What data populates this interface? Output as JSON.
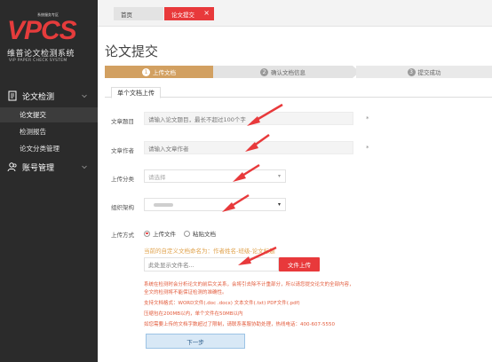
{
  "logo": {
    "top_small": "系统服务专区",
    "brand": "VPCS",
    "name_cn": "维普论文检测系统",
    "name_en": "VIP PAPER CHECK SYSTEM"
  },
  "sidebar": {
    "section1": "论文检测",
    "items": [
      "论文提交",
      "检测报告",
      "论文分类管理"
    ],
    "section2": "账号管理"
  },
  "tabs": {
    "home": "首页",
    "current": "论文提交"
  },
  "page": {
    "title": "论文提交"
  },
  "steps": [
    {
      "num": "1",
      "label": "上传文档"
    },
    {
      "num": "2",
      "label": "确认文档信息"
    },
    {
      "num": "3",
      "label": "提交成功"
    }
  ],
  "subtab": "单个文档上传",
  "form": {
    "title_label": "文章题目",
    "title_placeholder": "请输入论文题目，最长不超过100个字",
    "author_label": "文章作者",
    "author_placeholder": "请输入文章作者",
    "category_label": "上传分类",
    "category_value": "请选择",
    "org_label": "组织架构",
    "method_label": "上传方式",
    "radio_upload": "上传文件",
    "radio_paste": "粘贴文档",
    "hint_orange": "当前的自定义文档命名为：作者姓名-班级-论文标题",
    "file_placeholder": "此处显示文件名...",
    "upload_button": "文件上传",
    "notes": [
      "系统在检测时会分析论文的前后文关系，会将引去除不计重部分，所以请您提交论文的全部内容，",
      "全文的检测将不能保证检测的准确性。",
      "支持文档格式：WORD文件(.doc .docx) 文本文件(.txt) PDF文件(.pdf)",
      "压缩包在200MB以内，单个文件在50MB以内",
      "如您需要上传的文档字数超过了限制，请联系客服协助处理，热线电话：400-607-5550"
    ],
    "next_button": "下一步"
  },
  "colors": {
    "accent_red": "#e8393b",
    "step_gold": "#d2a061",
    "sidebar_bg": "#2b2b2b"
  }
}
